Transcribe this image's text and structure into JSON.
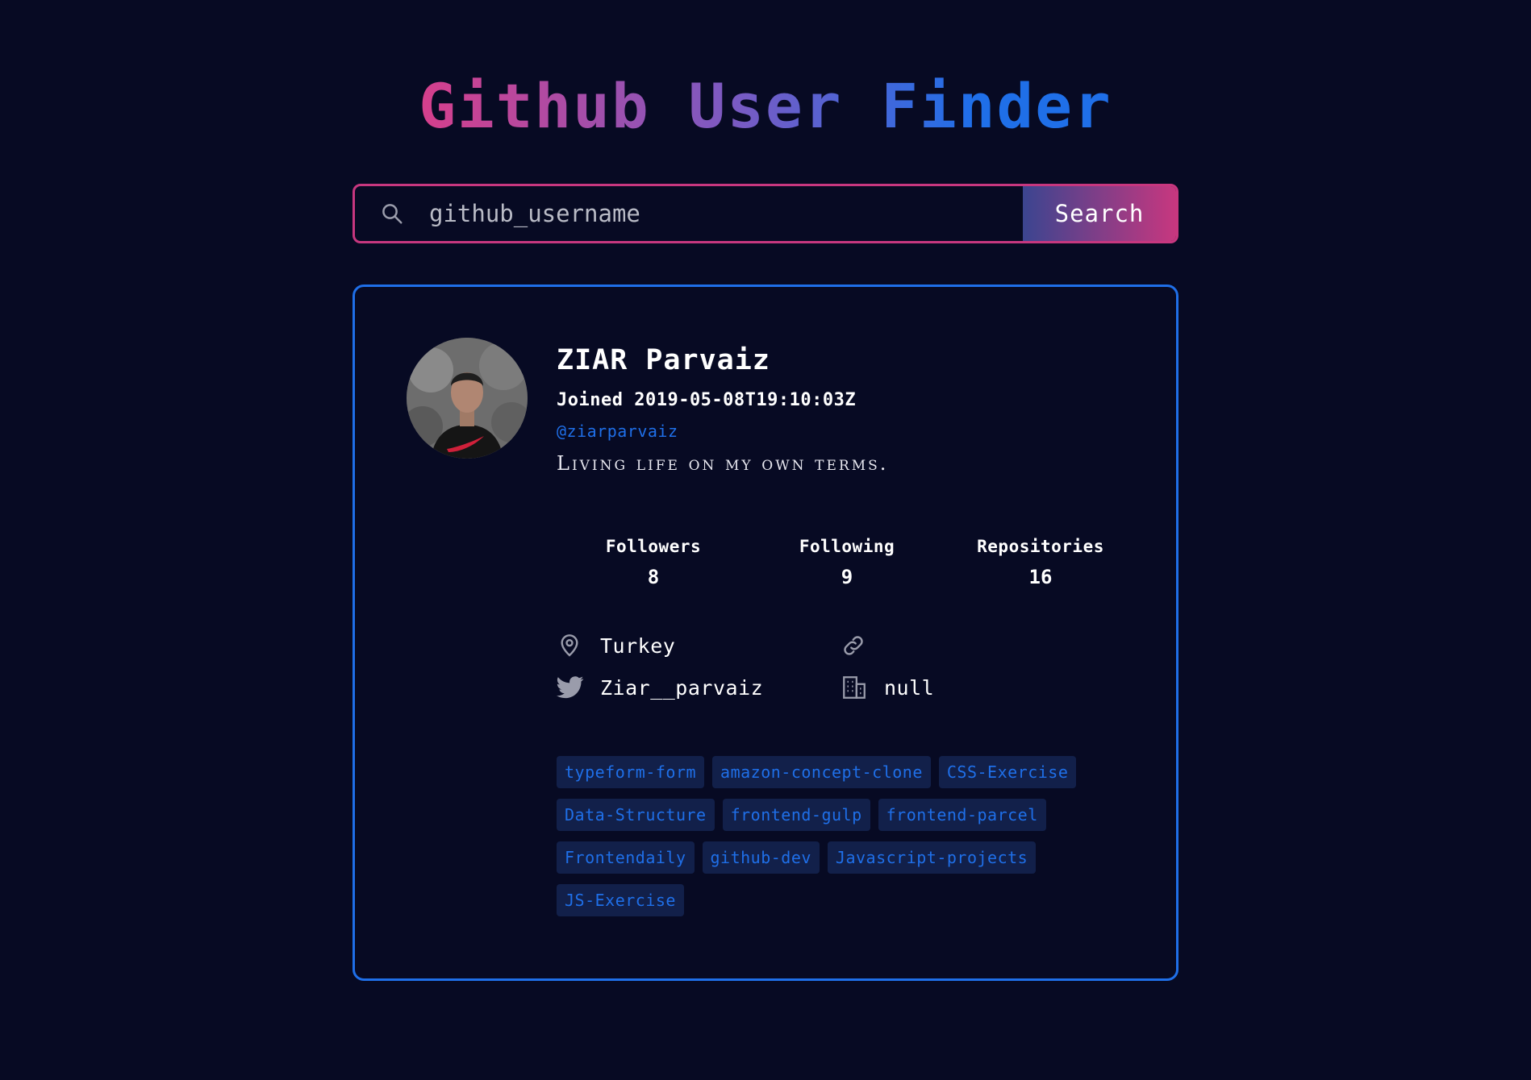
{
  "header": {
    "title": "Github User Finder"
  },
  "search": {
    "placeholder": "github_username",
    "value": "",
    "button_label": "Search",
    "icon": "search-icon"
  },
  "profile": {
    "name": "ZIAR Parvaiz",
    "joined": "Joined 2019-05-08T19:10:03Z",
    "login": "@ziarparvaiz",
    "bio": "Living life on my own terms.",
    "avatar": "avatar"
  },
  "stats": {
    "followers_label": "Followers",
    "followers": "8",
    "following_label": "Following",
    "following": "9",
    "repositories_label": "Repositories",
    "repositories": "16"
  },
  "links": {
    "location": "Turkey",
    "location_icon": "location-pin-icon",
    "blog": "",
    "blog_icon": "link-icon",
    "twitter": "Ziar__parvaiz",
    "twitter_icon": "twitter-icon",
    "company": "null",
    "company_icon": "building-icon"
  },
  "repos": [
    "typeform-form",
    "amazon-concept-clone",
    "CSS-Exercise",
    "Data-Structure",
    "frontend-gulp",
    "frontend-parcel",
    "Frontendaily",
    "github-dev",
    "Javascript-projects",
    "JS-Exercise"
  ],
  "colors": {
    "background": "#070a23",
    "accent_blue": "#1f6fe8",
    "accent_pink": "#c7377f",
    "tag_background": "#12204a"
  }
}
